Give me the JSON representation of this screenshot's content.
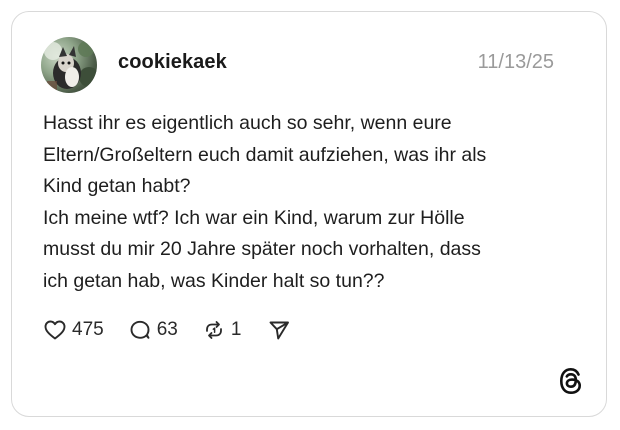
{
  "post": {
    "username": "cookiekaek",
    "date": "11/13/25",
    "lines": [
      "Hasst ihr es eigentlich auch so sehr, wenn eure",
      "Eltern/Großeltern euch damit aufziehen, was ihr als",
      "Kind getan habt?",
      "Ich meine wtf? Ich war ein Kind, warum zur Hölle",
      "musst du mir 20 Jahre später noch vorhalten, dass",
      "ich getan hab, was Kinder halt so tun??"
    ]
  },
  "actions": {
    "likes": "475",
    "replies": "63",
    "reposts": "1"
  },
  "icons": {
    "like": "heart-icon",
    "reply": "speech-bubble-icon",
    "repost": "repost-icon",
    "share": "send-icon",
    "brand": "threads-logo-icon"
  },
  "colors": {
    "text": "#1e1e1e",
    "muted": "#9a9a9a",
    "border": "#d9d9d9"
  }
}
